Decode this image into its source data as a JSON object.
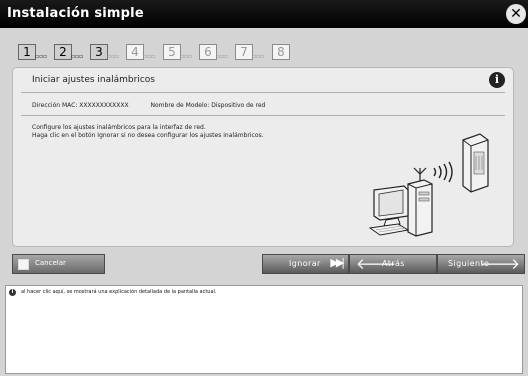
{
  "window": {
    "title": "Instalación simple",
    "close_symbol": "✕"
  },
  "steps": [
    {
      "label": "1",
      "state": "done"
    },
    {
      "label": "2",
      "state": "done"
    },
    {
      "label": "3",
      "state": "done"
    },
    {
      "label": "4",
      "state": "pending"
    },
    {
      "label": "5",
      "state": "pending"
    },
    {
      "label": "6",
      "state": "pending"
    },
    {
      "label": "7",
      "state": "pending"
    },
    {
      "label": "8",
      "state": "pending"
    }
  ],
  "step_separator": "▫▫▫",
  "panel": {
    "heading": "Iniciar ajustes inalámbricos",
    "info_symbol": "i",
    "mac_label": "Dirección MAC: XXXXXXXXXXXX",
    "model_label": "Nombre de Modelo: Dispositivo de red",
    "desc_line1": "Configure los ajustes inalámbricos para la interfaz de red.",
    "desc_line2": "Haga clic en el botón Ignorar si no desea configurar los ajustes inalámbricos."
  },
  "toolbar": {
    "cancel_label": "Cancelar",
    "skip_label": "Ignorar",
    "back_label": "Atrás",
    "next_label": "Siguiente"
  },
  "help": {
    "icon_symbol": "i",
    "text": "al hacer clic aquí, se mostrará una explicación detallada de la pantalla actual."
  },
  "icons": {
    "close": "close-icon",
    "info": "info-icon",
    "skip": "skip-forward-icon",
    "back": "arrow-left-icon",
    "next": "arrow-right-icon"
  }
}
